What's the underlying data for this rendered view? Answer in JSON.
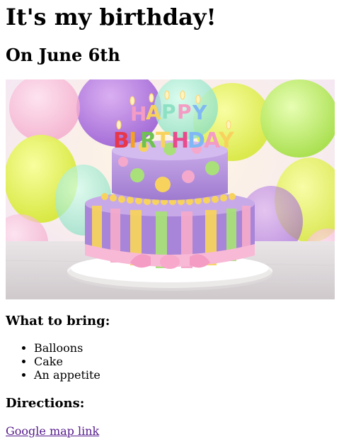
{
  "page": {
    "title": "It's my birthday!",
    "subtitle": "On June 6th",
    "image_alt": "birthday-cake-photo",
    "bring_heading": "What to bring:",
    "bring_items": [
      "Balloons",
      "Cake",
      "An appetite"
    ],
    "directions_heading": "Directions:",
    "map_link_text": "Google map link"
  },
  "cake_topper": {
    "happy": [
      "H",
      "A",
      "P",
      "P",
      "Y"
    ],
    "birthday": [
      "B",
      "I",
      "R",
      "T",
      "H",
      "D",
      "A",
      "Y"
    ]
  },
  "colors": {
    "link_visited": "#551a8b",
    "text": "#000000"
  }
}
